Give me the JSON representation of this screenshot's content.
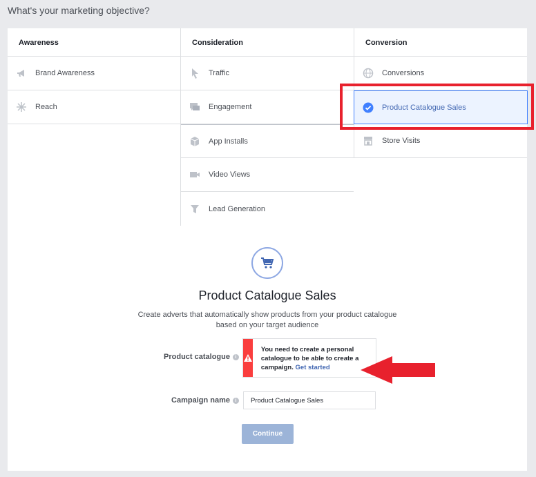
{
  "page": {
    "heading": "What's your marketing objective?"
  },
  "columns": [
    {
      "header": "Awareness",
      "items": [
        {
          "label": "Brand Awareness",
          "icon": "megaphone-icon"
        },
        {
          "label": "Reach",
          "icon": "reach-icon"
        }
      ]
    },
    {
      "header": "Consideration",
      "items": [
        {
          "label": "Traffic",
          "icon": "cursor-icon"
        },
        {
          "label": "Engagement",
          "icon": "chat-bubbles-icon"
        },
        {
          "label": "App Installs",
          "icon": "box-icon"
        },
        {
          "label": "Video Views",
          "icon": "video-camera-icon"
        },
        {
          "label": "Lead Generation",
          "icon": "funnel-icon"
        }
      ]
    },
    {
      "header": "Conversion",
      "items": [
        {
          "label": "Conversions",
          "icon": "globe-icon"
        },
        {
          "label": "Product Catalogue Sales",
          "icon": "check-circle-icon",
          "selected": true
        },
        {
          "label": "Store Visits",
          "icon": "store-icon"
        }
      ]
    }
  ],
  "detail": {
    "icon": "shopping-cart-icon",
    "title": "Product Catalogue Sales",
    "description": "Create adverts that automatically show products from your product catalogue based on your target audience",
    "catalogue_label": "Product catalogue",
    "warning_text": "You need to create a personal catalogue to be able to create a campaign.",
    "warning_link": "Get started",
    "campaign_label": "Campaign name",
    "campaign_value": "Product Catalogue Sales",
    "continue_label": "Continue"
  },
  "colors": {
    "accent": "#4080ff",
    "selected_bg": "#ecf3ff",
    "warning": "#fa3e3e",
    "highlight": "#e8212d",
    "button_disabled": "#9cb4d8"
  }
}
